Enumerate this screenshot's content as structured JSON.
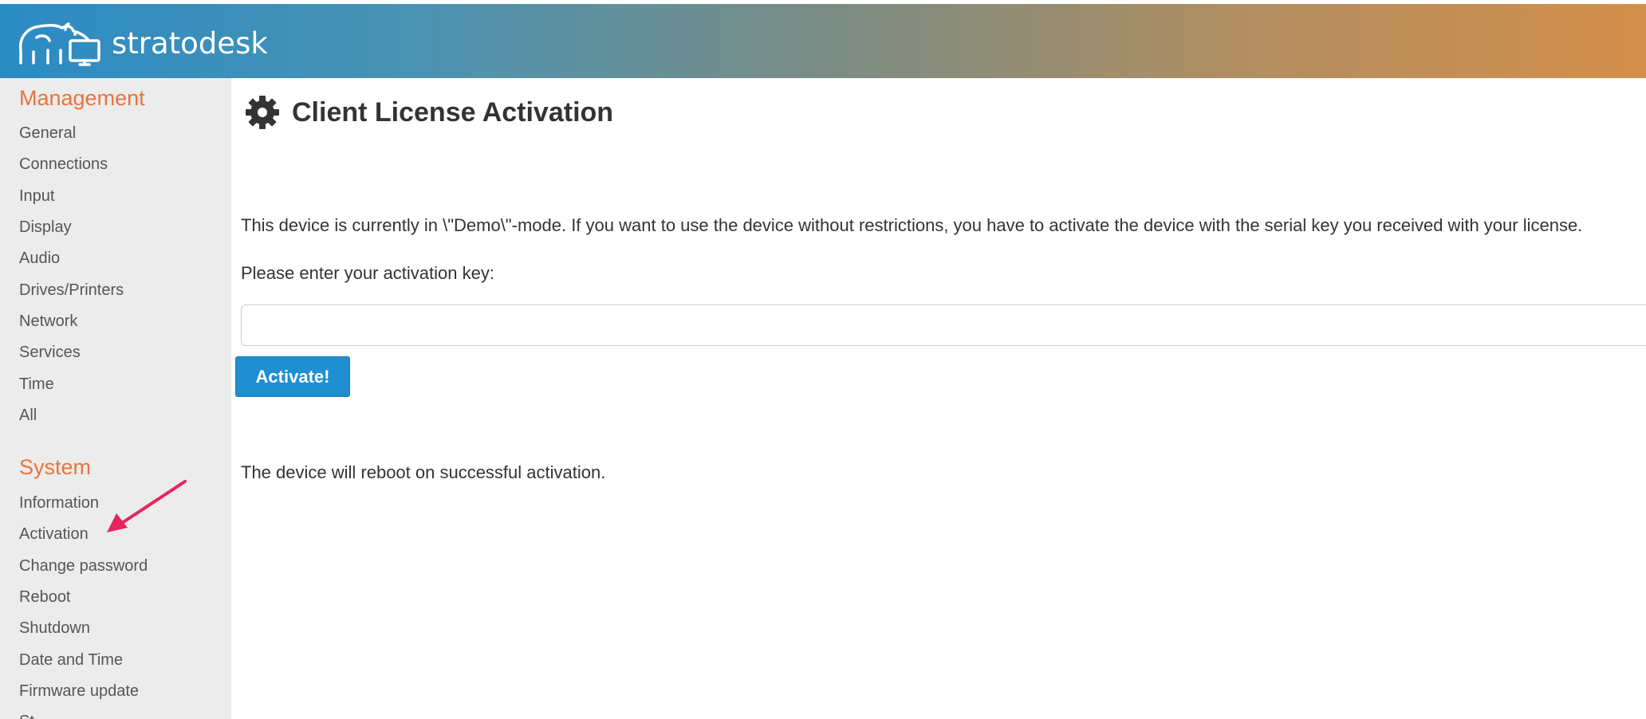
{
  "header": {
    "brand": "stratodesk",
    "logo_icon": "polar-bear-monitor-logo",
    "gradient_colors": [
      "#2a8bc4",
      "#d48f4a"
    ]
  },
  "sidebar": {
    "management": {
      "title": "Management",
      "items": [
        {
          "label": "General"
        },
        {
          "label": "Connections"
        },
        {
          "label": "Input"
        },
        {
          "label": "Display"
        },
        {
          "label": "Audio"
        },
        {
          "label": "Drives/Printers"
        },
        {
          "label": "Network"
        },
        {
          "label": "Services"
        },
        {
          "label": "Time"
        },
        {
          "label": "All"
        }
      ]
    },
    "system": {
      "title": "System",
      "items": [
        {
          "label": "Information"
        },
        {
          "label": "Activation"
        },
        {
          "label": "Change password"
        },
        {
          "label": "Reboot"
        },
        {
          "label": "Shutdown"
        },
        {
          "label": "Date and Time"
        },
        {
          "label": "Firmware update"
        }
      ]
    },
    "accent_color": "#e8743b"
  },
  "main": {
    "title": "Client License Activation",
    "title_icon": "gear-icon",
    "intro": "This device is currently in \\\"Demo\\\"-mode. If you want to use the device without restrictions, you have to activate the device with the serial key you received with your license.",
    "prompt": "Please enter your activation key:",
    "input_value": "",
    "button_label": "Activate!",
    "reboot_note": "The device will reboot on successful activation.",
    "button_color": "#1f8fd1"
  },
  "annotation": {
    "arrow_color": "#e8245c",
    "arrow_icon": "pointer-arrow"
  }
}
